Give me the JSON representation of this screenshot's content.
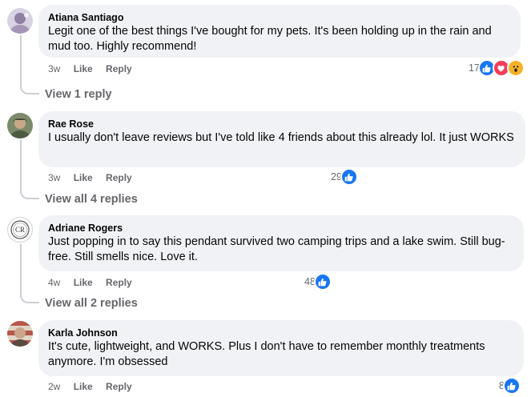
{
  "comments": [
    {
      "author": "Atiana Santiago",
      "text": "Legit one of the best things I've bought for my pets. It's been holding up in the rain and mud too. Highly recommend!",
      "time": "3w",
      "like_label": "Like",
      "reply_label": "Reply",
      "reaction_count": "17",
      "reaction_icons": [
        "like-icon",
        "love-icon",
        "wow-icon"
      ],
      "view_replies": "View 1 reply",
      "avatar_colors": [
        "#c9c4d6",
        "#8e7fa3"
      ]
    },
    {
      "author": "Rae Rose",
      "text": "I usually don't leave reviews but I've told like 4 friends about this already lol. It just WORKS",
      "time": "3w",
      "like_label": "Like",
      "reply_label": "Reply",
      "reaction_count": "29",
      "reaction_icons": [
        "like-icon"
      ],
      "view_replies": "View all 4 replies",
      "avatar_colors": [
        "#6d7b5e",
        "#3f4a36"
      ]
    },
    {
      "author": "Adriane Rogers",
      "text": "Just popping in to say this pendant survived two camping trips and a lake swim. Still bug-free. Still smells nice. Love it.",
      "time": "4w",
      "like_label": "Like",
      "reply_label": "Reply",
      "reaction_count": "48",
      "reaction_icons": [
        "like-icon"
      ],
      "view_replies": "View all 2 replies",
      "avatar_monogram": "CR"
    },
    {
      "author": "Karla Johnson",
      "text": "It's cute, lightweight, and WORKS. Plus I don't have to remember monthly treatments anymore. I'm obsessed",
      "time": "2w",
      "like_label": "Like",
      "reply_label": "Reply",
      "reaction_count": "8",
      "reaction_icons": [
        "like-icon"
      ],
      "avatar_colors": [
        "#b5574a",
        "#e0d6c8"
      ]
    }
  ],
  "colors": {
    "bubble": "#f0f2f5",
    "meta_text": "#65676b",
    "like_blue": "#1877f2",
    "love_red": "#f33e58",
    "wow_yellow": "#f7b125",
    "thread_line": "#ccd0d5"
  }
}
